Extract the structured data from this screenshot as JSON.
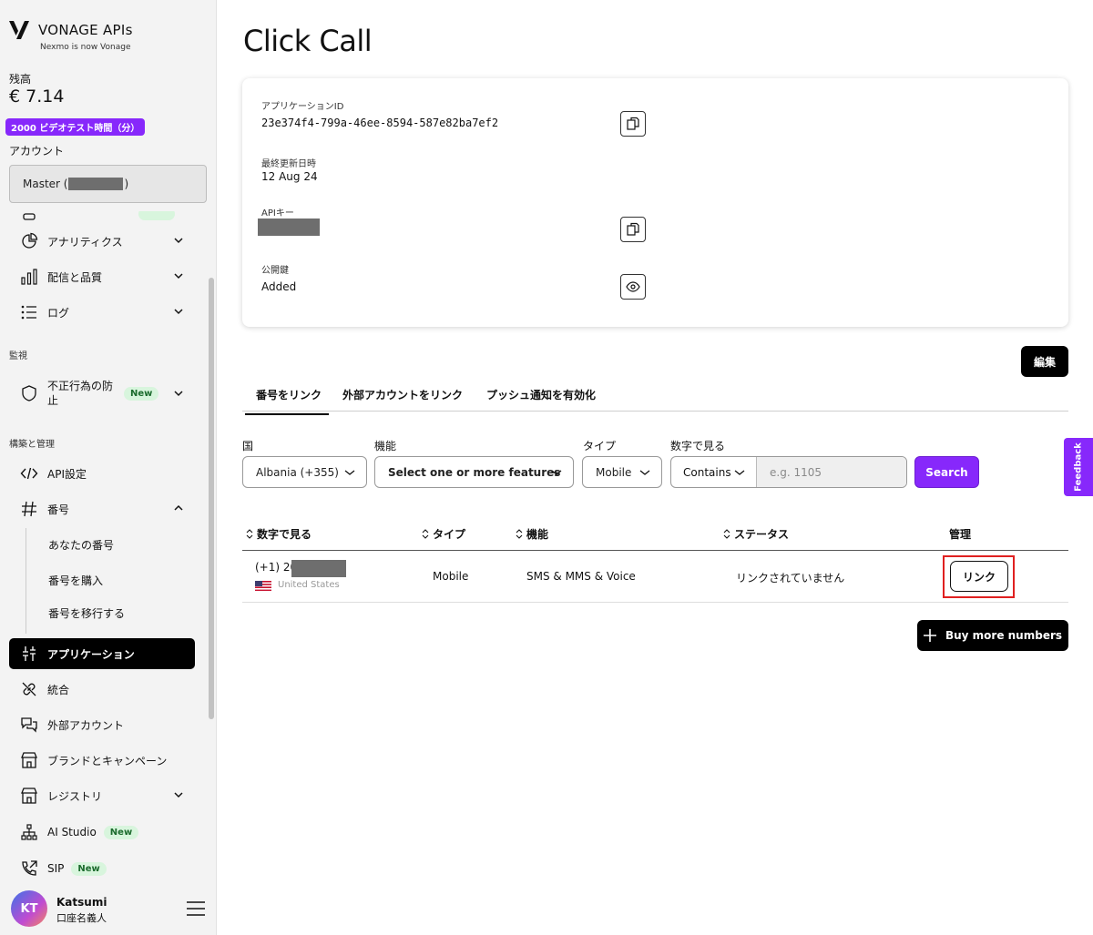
{
  "sidebar": {
    "brand": "VONAGE APIs",
    "brand_sub": "Nexmo is now Vonage",
    "balance_label": "残高",
    "balance_value": "€ 7.14",
    "video_badge": "2000 ビデオテスト時間（分）",
    "account_label": "アカウント",
    "account_prefix": "Master (",
    "account_suffix": ")",
    "nav": {
      "analytics": "アナリティクス",
      "delivery": "配信と品質",
      "logs": "ログ",
      "section_monitoring": "監視",
      "fraud": "不正行為の防止",
      "section_build": "構築と管理",
      "api_settings": "API設定",
      "numbers": "番号",
      "your_numbers": "あなたの番号",
      "buy_numbers": "番号を購入",
      "port_numbers": "番号を移行する",
      "applications": "アプリケーション",
      "integrations": "統合",
      "external_accounts": "外部アカウント",
      "brands_campaigns": "ブランドとキャンペーン",
      "registry": "レジストリ",
      "ai_studio": "AI Studio",
      "sip": "SIP"
    },
    "new_badge": "New",
    "user": {
      "initials": "KT",
      "name": "Katsumi",
      "role": "口座名義人"
    }
  },
  "main": {
    "title": "Click Call",
    "app_id_label": "アプリケーションID",
    "app_id_value": "23e374f4-799a-46ee-8594-587e82ba7ef2",
    "updated_label": "最終更新日時",
    "updated_value": "12 Aug 24",
    "api_key_label": "APIキー",
    "public_key_label": "公開鍵",
    "public_key_value": "Added",
    "edit_button": "編集",
    "tabs": [
      "番号をリンク",
      "外部アカウントをリンク",
      "プッシュ通知を有効化"
    ],
    "filters": {
      "country_label": "国",
      "country_value": "Albania (+355)",
      "feature_label": "機能",
      "feature_value": "Select one or more features",
      "type_label": "タイプ",
      "type_value": "Mobile",
      "number_label": "数字で見る",
      "match_value": "Contains",
      "number_placeholder": "e.g. 1105",
      "search_button": "Search"
    },
    "table": {
      "headers": [
        "数字で見る",
        "タイプ",
        "機能",
        "ステータス",
        "管理"
      ],
      "rows": [
        {
          "number_prefix": "(+1) 20",
          "country": "United States",
          "type": "Mobile",
          "features": "SMS & MMS & Voice",
          "status": "リンクされていません",
          "action": "リンク"
        }
      ]
    },
    "buy_more_button": "Buy more numbers",
    "feedback": "Feedback"
  }
}
